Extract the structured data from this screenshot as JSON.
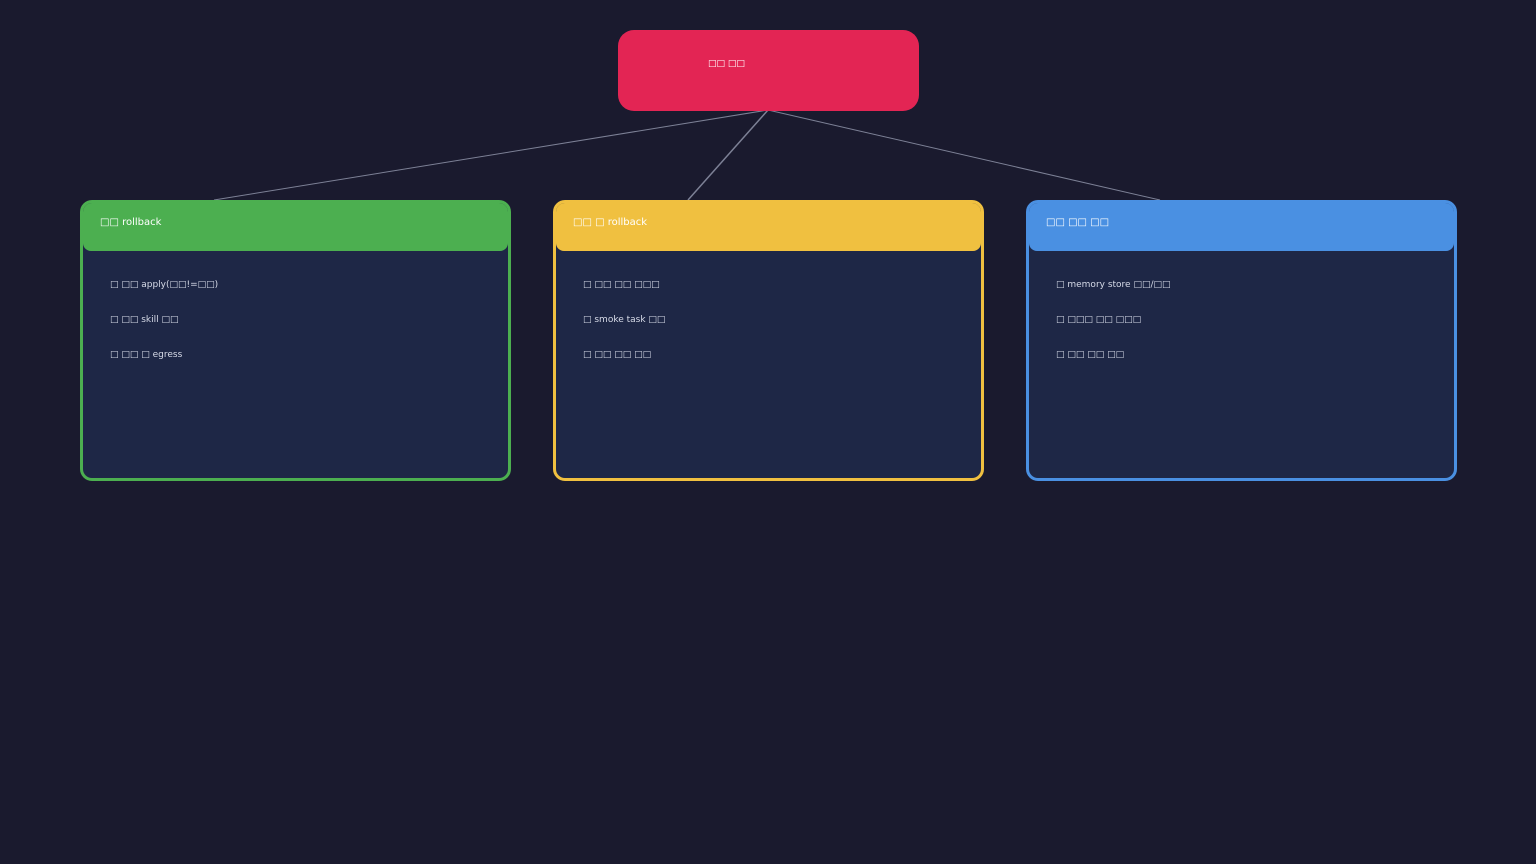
{
  "colors": {
    "background": "#1a1a2e",
    "root": "#e32554",
    "connector": "#7d8196",
    "card_body": "#1e2746",
    "green": "#4caf50",
    "yellow": "#f0c040",
    "blue": "#4a90e2"
  },
  "root": {
    "label": "□□ □□"
  },
  "cards": [
    {
      "title": "□□ rollback",
      "color": "#4caf50",
      "items": [
        "□ □□ apply(□□!=□□)",
        "□ □□ skill □□",
        "□ □□ □ egress"
      ]
    },
    {
      "title": "□□ □ rollback",
      "color": "#f0c040",
      "items": [
        "□ □□ □□ □□□",
        "□ smoke task □□",
        "□ □□ □□ □□"
      ]
    },
    {
      "title": "□□ □□ □□",
      "color": "#4a90e2",
      "items": [
        "□ memory store □□/□□",
        "□ □□□ □□ □□□",
        "□ □□ □□ □□"
      ]
    }
  ]
}
